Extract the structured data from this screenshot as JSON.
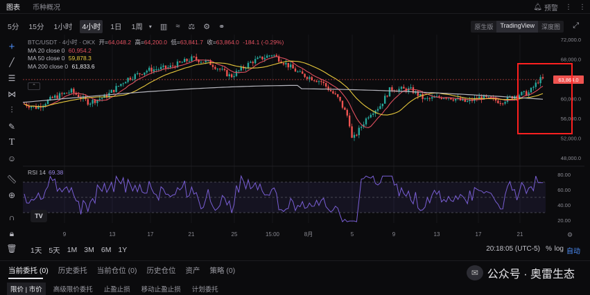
{
  "top_tabs": [
    {
      "label": "图表",
      "active": true
    },
    {
      "label": "币种概况",
      "active": false
    }
  ],
  "top_right": {
    "alert_label": "预警"
  },
  "timeframes": [
    {
      "label": "5分",
      "active": false
    },
    {
      "label": "15分",
      "active": false
    },
    {
      "label": "1小时",
      "active": false
    },
    {
      "label": "4小时",
      "active": true
    },
    {
      "label": "1日",
      "active": false
    },
    {
      "label": "1周",
      "active": false
    }
  ],
  "toolbar_icons": [
    "indicators-icon",
    "compare-icon",
    "settings-icon",
    "template-icon"
  ],
  "view_modes": [
    {
      "label": "原生版",
      "active": false
    },
    {
      "label": "TradingView",
      "active": true
    },
    {
      "label": "深度图",
      "active": false
    }
  ],
  "left_tools": [
    "crosshair-icon",
    "trendline-icon",
    "horizontal-lines-icon",
    "pattern-icon",
    "fib-icon",
    "brush-icon",
    "text-icon",
    "emoji-icon",
    "ruler-icon",
    "zoom-icon",
    "magnet-icon",
    "lock-icon",
    "trash-icon"
  ],
  "legend": {
    "symbol": "BTC/USDT · 4小时 · OKX",
    "open_label": "开=",
    "open": "64,048.2",
    "high_label": "高=",
    "high": "64,200.0",
    "low_label": "低=",
    "low": "63,841.7",
    "close_label": "收=",
    "close": "63,864.0",
    "change": "-184.1 (-0.29%)",
    "ma": [
      {
        "label": "MA 20 close 0",
        "value": "60,954.2",
        "color": "#e0505f"
      },
      {
        "label": "MA 50 close 0",
        "value": "59,878.3",
        "color": "#e8c93c"
      },
      {
        "label": "MA 200 close 0",
        "value": "61,833.6",
        "color": "#c9c9cf"
      }
    ]
  },
  "price_badge": "63,864.0",
  "price_axis": [
    "72,000.0",
    "68,000.0",
    "64,000.0",
    "60,000.0",
    "56,000.0",
    "52,000.0",
    "48,000.0"
  ],
  "rsi": {
    "label": "RSI 14",
    "value": "69.38",
    "axis": [
      "80.00",
      "60.00",
      "40.00",
      "20.00"
    ]
  },
  "time_axis": [
    "9",
    "13",
    "17",
    "21",
    "25",
    "15:00",
    "8月",
    "5",
    "9",
    "13",
    "17",
    "21"
  ],
  "tv_logo": "TV",
  "ranges": [
    "1天",
    "5天",
    "1M",
    "3M",
    "6M",
    "1Y"
  ],
  "clock": "20:18:05 (UTC-5)",
  "scale_options": {
    "percent": "%",
    "log": "log",
    "auto": "自动"
  },
  "order_tabs": [
    "当前委托 (0)",
    "历史委托",
    "当前仓位 (0)",
    "历史仓位",
    "资产",
    "策略 (0)"
  ],
  "order_subtabs": [
    "限价 | 市价",
    "高级限价委托",
    "止盈止损",
    "移动止盈止损",
    "计划委托"
  ],
  "watermark": "公众号 · 奥雷生态",
  "colors": {
    "up": "#26a69a",
    "down": "#ef5350",
    "accent": "#4c8df6",
    "rsi": "#7a5fd6",
    "highlight_box": "#ff2020"
  }
}
